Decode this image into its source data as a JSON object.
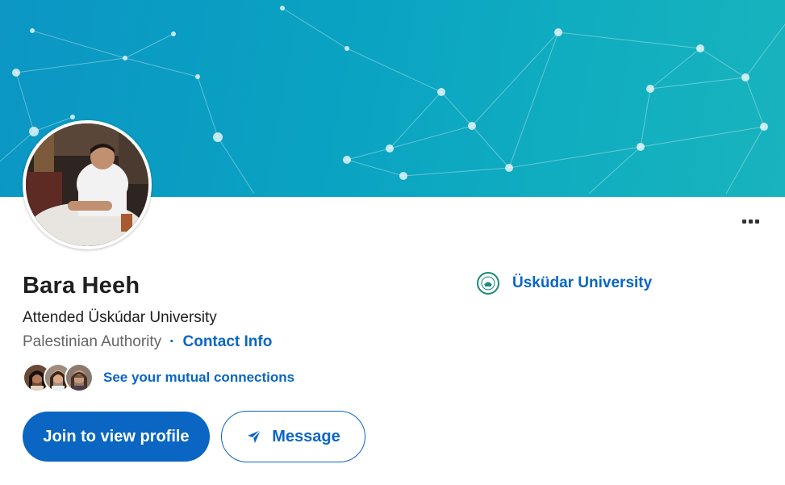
{
  "profile": {
    "name": "Bara Heeh",
    "headline": "Attended Üskúdar University",
    "location": "Palestinian Authority",
    "separator": "·",
    "contact_info": "Contact Info",
    "mutual_connections": "See your mutual connections"
  },
  "actions": {
    "join_label": "Join to view profile",
    "message_label": "Message",
    "more_icon": "more-horizontal-icon"
  },
  "education": {
    "school_name": "Üsküdar University",
    "logo_icon": "university-logo"
  },
  "colors": {
    "brand_blue": "#0a66c2",
    "banner_teal": "#0aa3c2"
  }
}
